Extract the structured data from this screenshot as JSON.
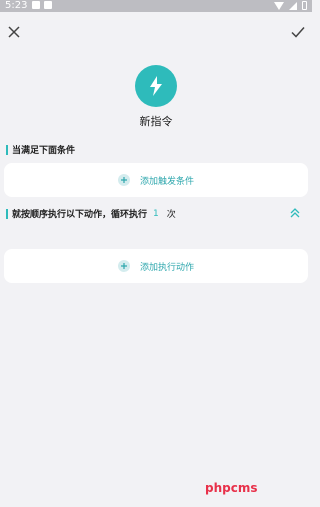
{
  "status_bar": {
    "time": "5:23"
  },
  "header": {
    "close_icon": "close-icon",
    "confirm_icon": "check-icon"
  },
  "command": {
    "icon": "lightning-icon",
    "name": "新指令",
    "accent_color": "#2ebbbb"
  },
  "conditions": {
    "title": "当满足下面条件",
    "add_label": "添加触发条件"
  },
  "actions": {
    "title": "就按顺序执行以下动作，循环执行",
    "loop_count": "1",
    "loop_unit": "次",
    "add_label": "添加执行动作"
  },
  "watermark": "phpcms"
}
